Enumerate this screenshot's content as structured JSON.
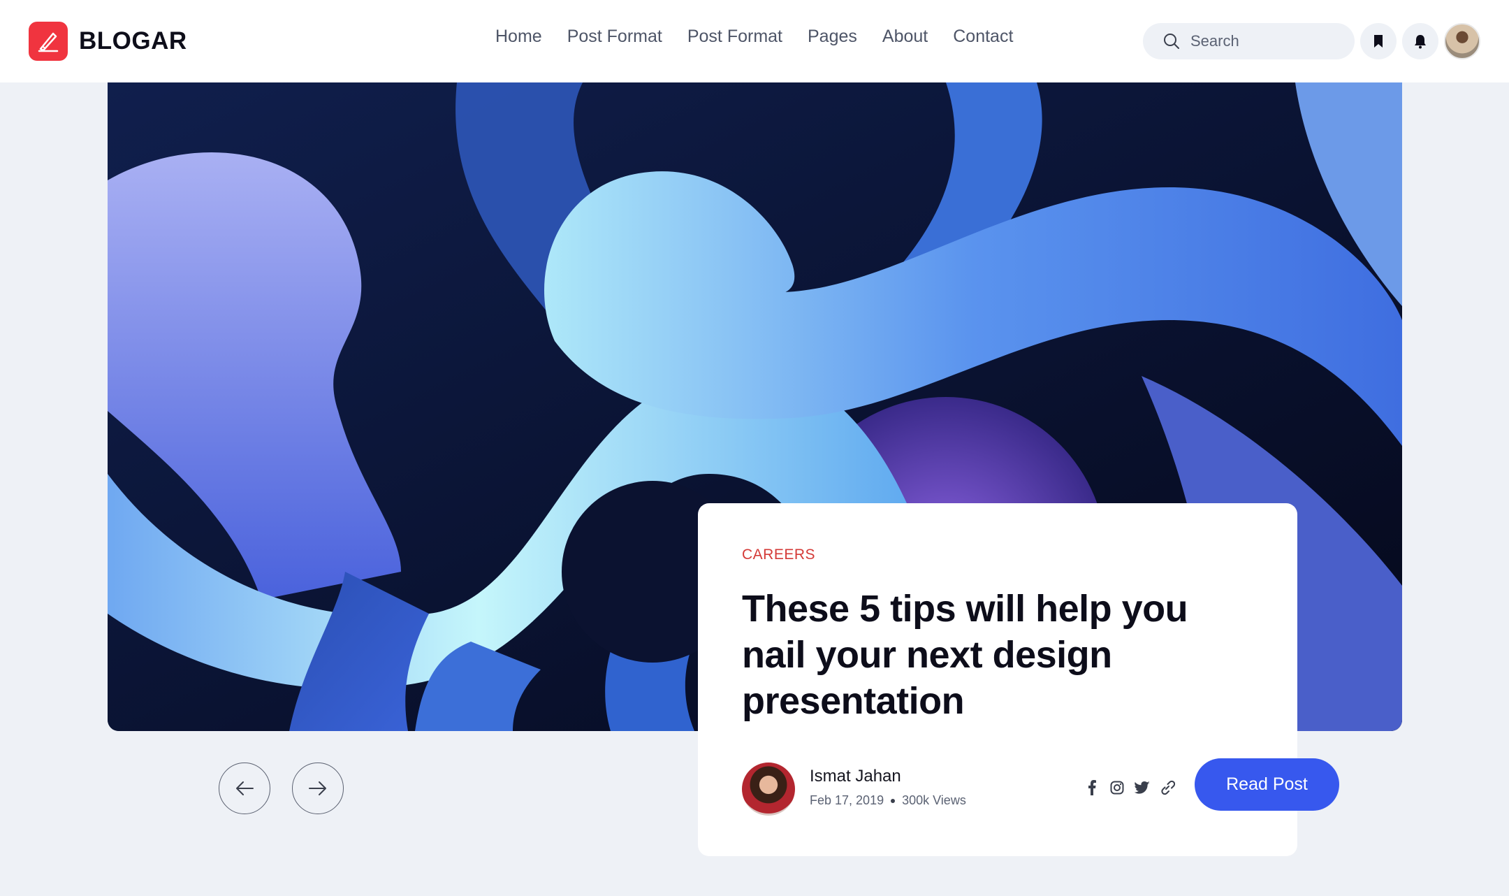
{
  "header": {
    "logo_text": "BLOGAR",
    "logo_icon": "pen-icon",
    "nav": [
      "Home",
      "Post Format",
      "Post Format",
      "Pages",
      "About",
      "Contact"
    ],
    "search": {
      "placeholder": "Search",
      "icon": "search-icon"
    },
    "buttons": {
      "bookmark_icon": "bookmark-icon",
      "bell_icon": "bell-icon"
    }
  },
  "hero": {
    "image": "abstract-blue-3d-ribbons",
    "prev_icon": "arrow-left-icon",
    "next_icon": "arrow-right-icon"
  },
  "post": {
    "category": "CAREERS",
    "title": "These 5 tips will help you nail your next design presentation",
    "author": "Ismat Jahan",
    "date": "Feb 17, 2019",
    "views": "300k Views",
    "socials": [
      "facebook-icon",
      "instagram-icon",
      "twitter-icon",
      "link-icon"
    ],
    "cta": "Read Post"
  },
  "colors": {
    "brand": "#f0343f",
    "accent": "#3758ee",
    "category": "#d43a37",
    "background": "#eef1f6"
  }
}
